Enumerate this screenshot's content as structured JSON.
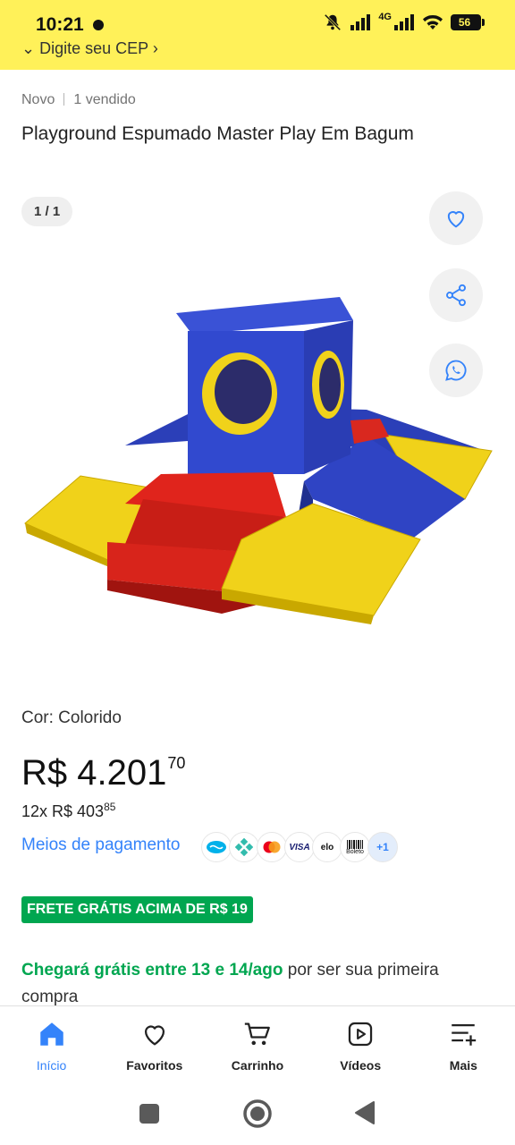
{
  "status_bar": {
    "time": "10:21",
    "network": "4G",
    "battery": "56"
  },
  "header": {
    "cep_prompt": "Digite seu CEP"
  },
  "product": {
    "condition": "Novo",
    "sold": "1 vendido",
    "title": "Playground Espumado Master Play Em Bagum",
    "image_counter": "1 / 1",
    "color_line": "Cor: Colorido",
    "price_main": "R$ 4.201",
    "price_cents": "70",
    "installment_main": "12x R$ 403",
    "installment_cents": "85",
    "payment_link": "Meios de pagamento",
    "payment_methods": [
      "mercado-pago",
      "pix",
      "mastercard",
      "VISA",
      "elo",
      "Boleto",
      "+1"
    ],
    "free_shipping_badge": "FRETE GRÁTIS ACIMA DE R$ 19",
    "arrival_green": "Chegará grátis entre 13 e 14/ago",
    "arrival_rest": "por ser sua primeira compra"
  },
  "bottom_nav": {
    "items": [
      {
        "label": "Início",
        "icon": "home-icon",
        "active": true
      },
      {
        "label": "Favoritos",
        "icon": "heart-icon"
      },
      {
        "label": "Carrinho",
        "icon": "cart-icon"
      },
      {
        "label": "Vídeos",
        "icon": "video-icon"
      },
      {
        "label": "Mais",
        "icon": "menu-plus-icon"
      }
    ]
  },
  "colors": {
    "header_yellow": "#fff159",
    "link_blue": "#3483fa",
    "shipping_green": "#00a650"
  }
}
